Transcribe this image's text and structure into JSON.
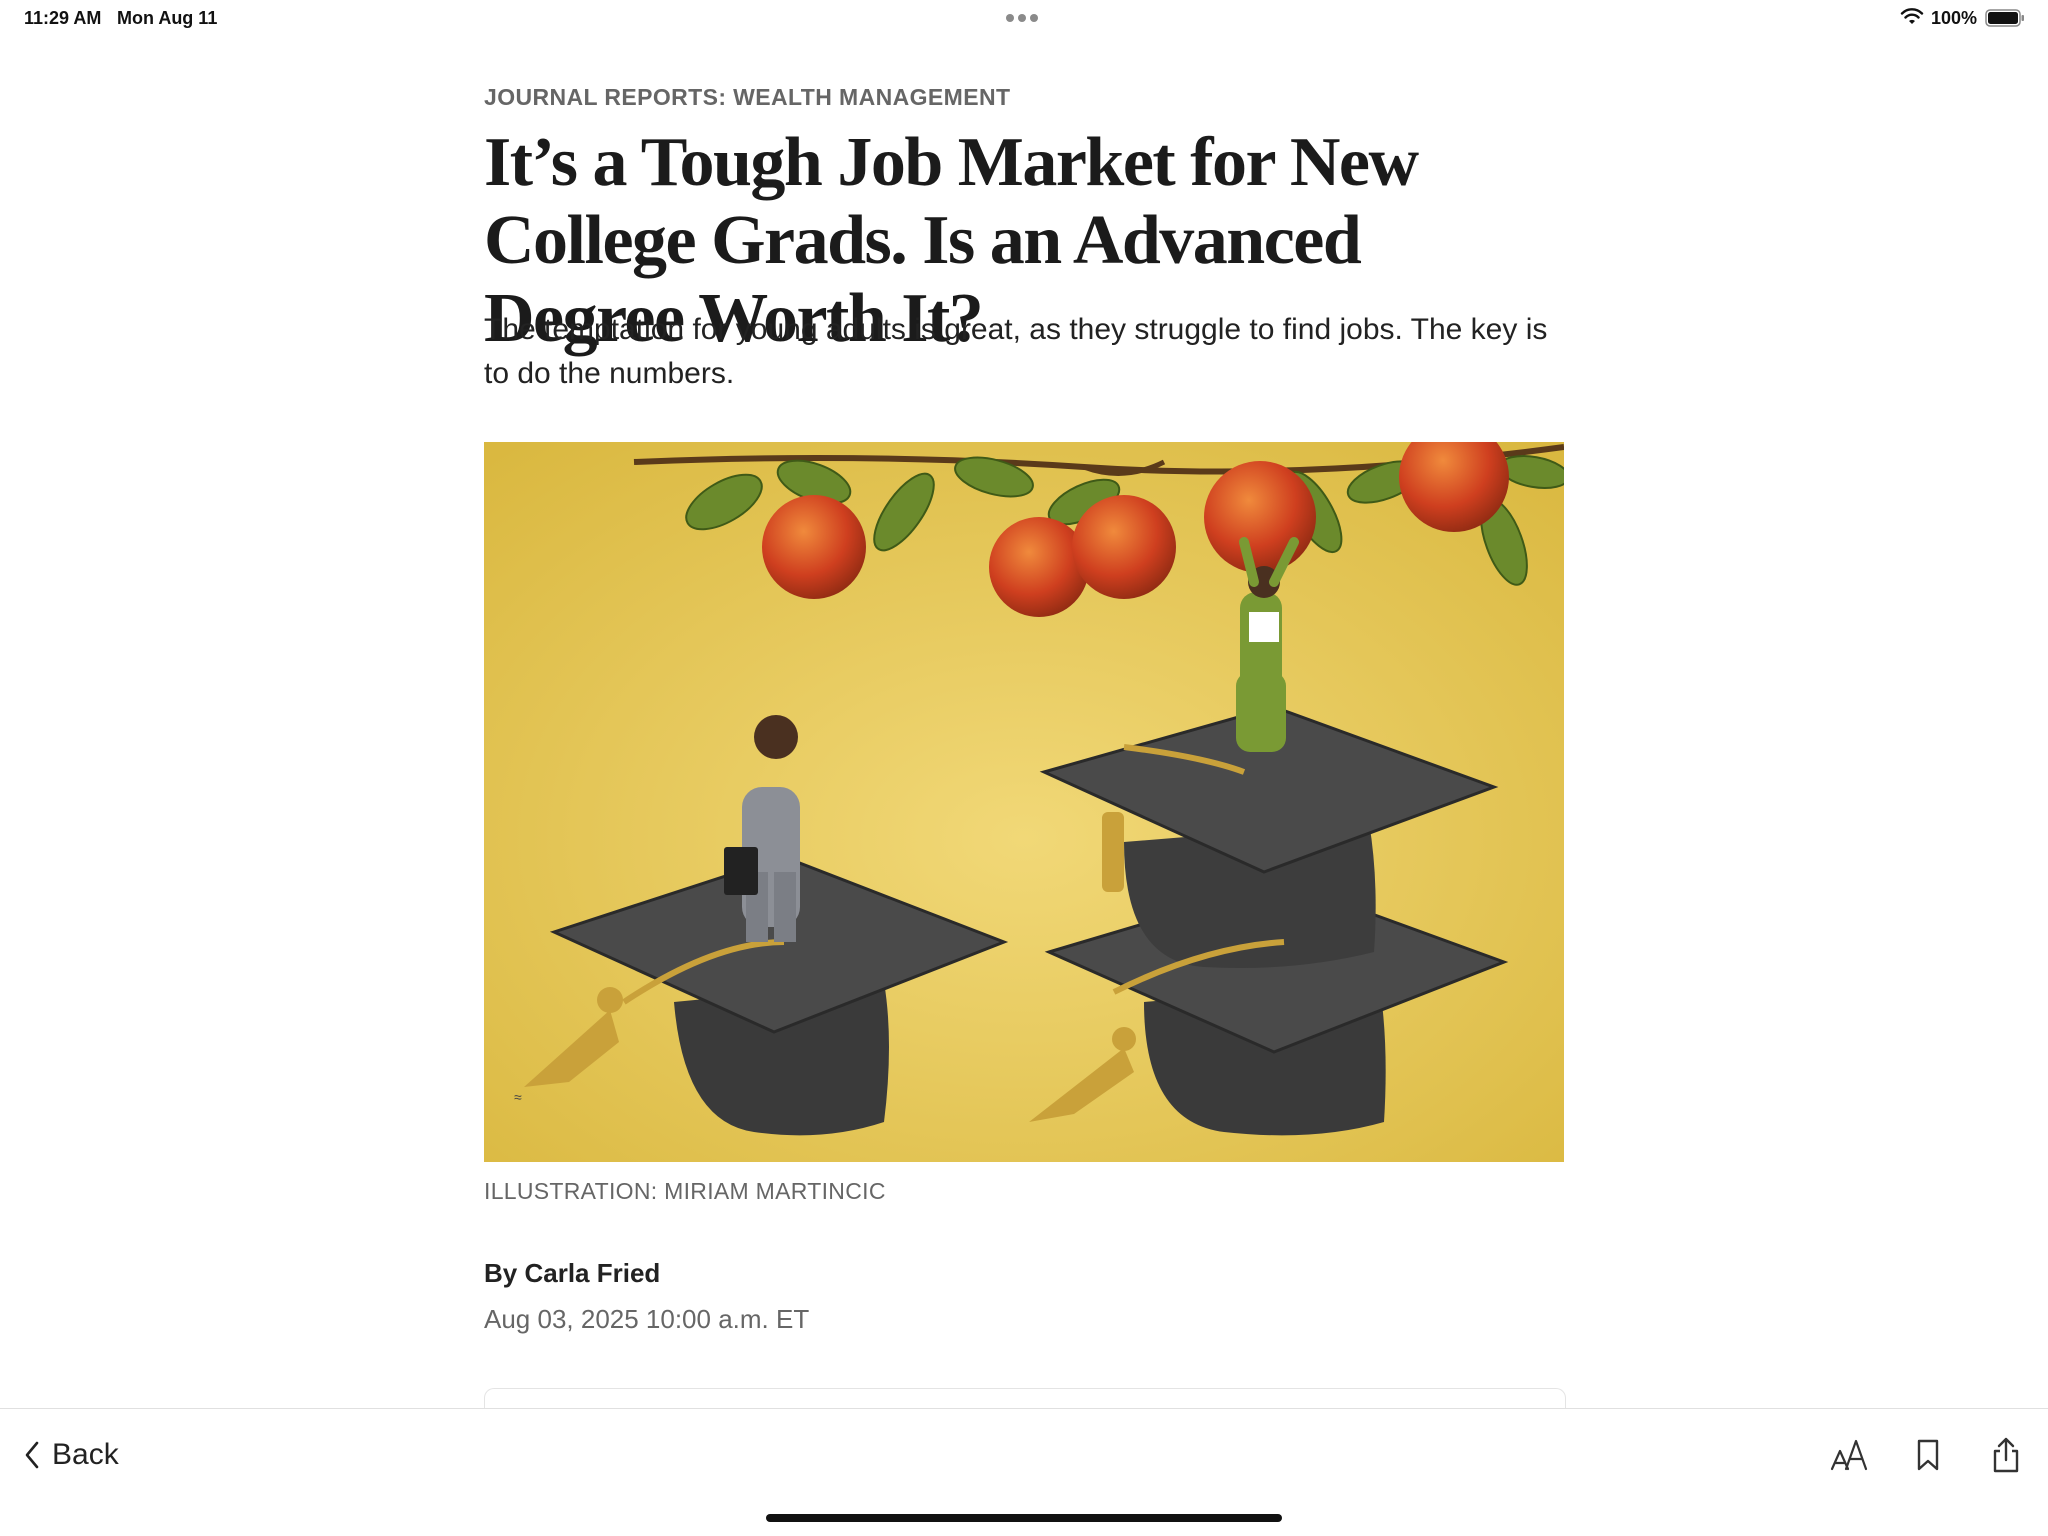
{
  "status_bar": {
    "time": "11:29 AM",
    "date": "Mon Aug 11",
    "battery_percent": "100%",
    "icons": [
      "wifi-icon",
      "battery-icon",
      "multitasking-dots-icon"
    ]
  },
  "article": {
    "kicker": "JOURNAL REPORTS: WEALTH MANAGEMENT",
    "headline": "It’s a Tough Job Market for New College Grads. Is an Advanced Degree Worth It?",
    "dek": "The temptation for young adults is great, as they struggle to find jobs. The key is to do the numbers.",
    "image_caption": "ILLUSTRATION: MIRIAM MARTINCIC",
    "byline": "By Carla Fried",
    "dateline": "Aug 03, 2025 10:00 a.m. ET"
  },
  "toolbar": {
    "back_label": "Back",
    "icons": [
      "chevron-left-icon",
      "text-size-icon",
      "bookmark-icon",
      "share-icon"
    ]
  },
  "colors": {
    "kicker": "#666666",
    "headline": "#1b1b1b",
    "illustration_background": "#e7c85a"
  }
}
